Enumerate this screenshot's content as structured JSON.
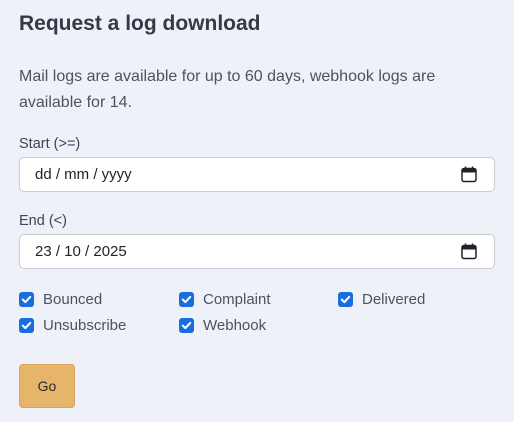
{
  "form": {
    "title": "Request a log download",
    "description": "Mail logs are available for up to 60 days, webhook logs are available for 14.",
    "start": {
      "label": "Start (>=)",
      "value": "dd / mm / yyyy"
    },
    "end": {
      "label": "End (<)",
      "value": "23 / 10 / 2025"
    },
    "checkboxes": [
      {
        "label": "Bounced",
        "checked": true
      },
      {
        "label": "Complaint",
        "checked": true
      },
      {
        "label": "Delivered",
        "checked": true
      },
      {
        "label": "Unsubscribe",
        "checked": true
      },
      {
        "label": "Webhook",
        "checked": true
      }
    ],
    "submit_label": "Go"
  },
  "colors": {
    "background": "#eef1f8",
    "checkbox": "#1a6de0",
    "button": "#e6b46b"
  },
  "icons": {
    "date_picker": "calendar-icon",
    "checkbox": "checkmark-icon"
  }
}
